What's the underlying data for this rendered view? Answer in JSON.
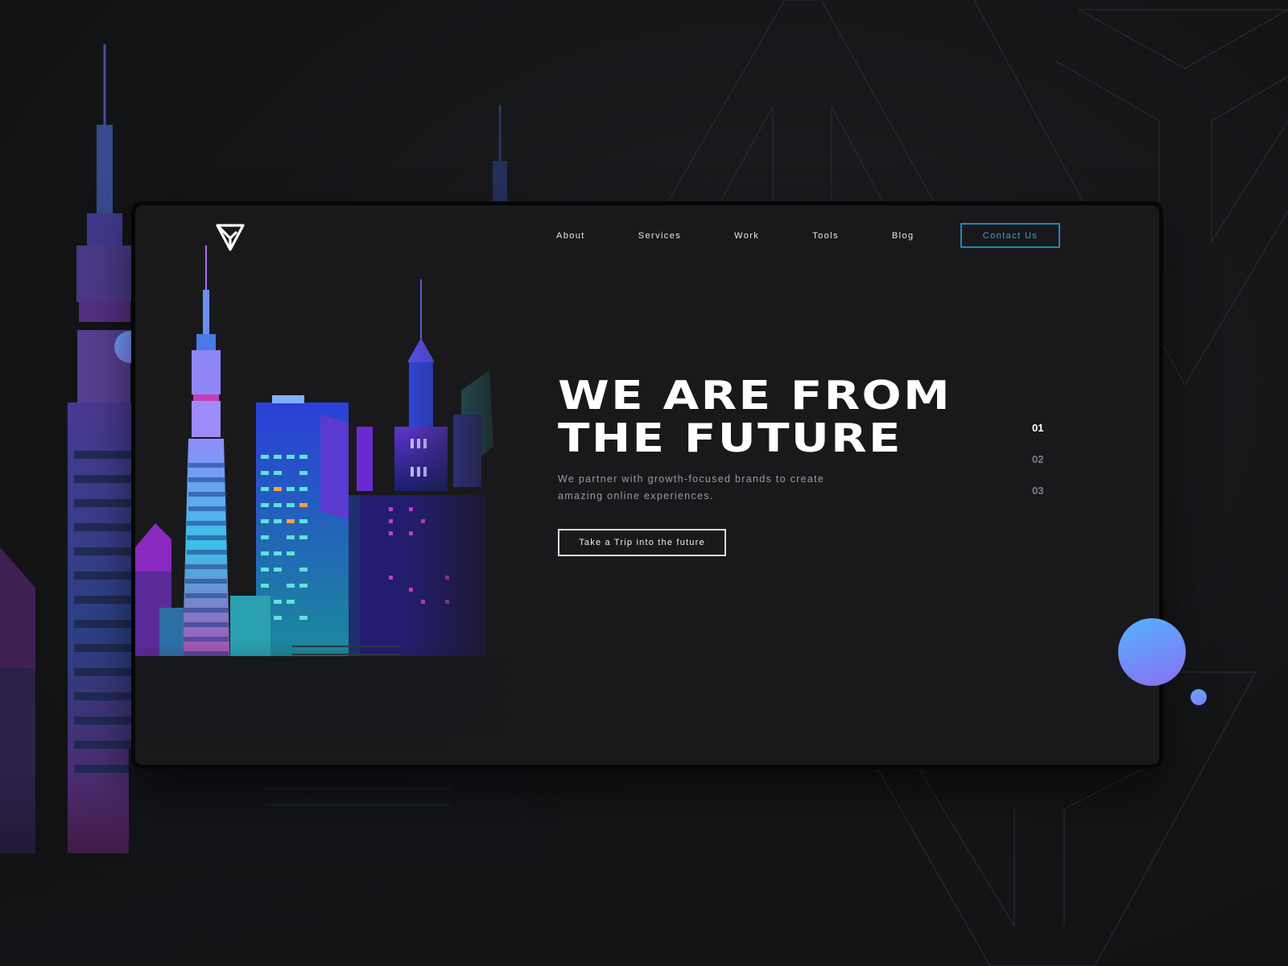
{
  "nav": {
    "items": [
      "About",
      "Services",
      "Work",
      "Tools",
      "Blog"
    ],
    "contact_label": "Contact Us"
  },
  "hero": {
    "title_line1": "WE ARE FROM",
    "title_line2": "THE FUTURE",
    "subtitle_line1": "We partner with growth-focused brands to create",
    "subtitle_line2": "amazing online experiences.",
    "cta_label": "Take a Trip into the future"
  },
  "pager": {
    "items": [
      "01",
      "02",
      "03"
    ],
    "active_index": 0
  },
  "colors": {
    "accent": "#2ba7da",
    "orb_start": "#5aaeff",
    "orb_end": "#8a70f0",
    "background": "#141517",
    "card": "#19191b"
  },
  "icons": {
    "logo": "triangle-logo-icon"
  }
}
